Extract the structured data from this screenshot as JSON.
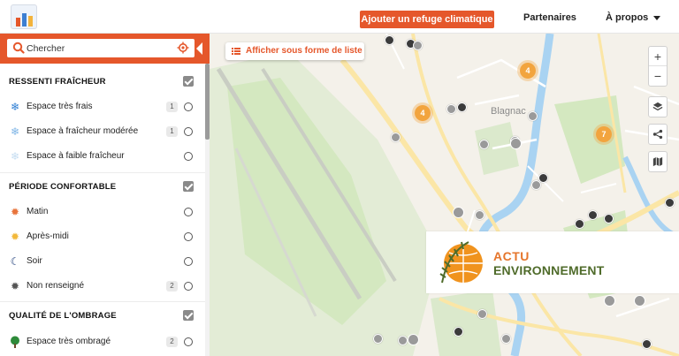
{
  "header": {
    "logo": "refuge-logo",
    "add_refuge_button": "Ajouter un refuge climatique",
    "partners_link": "Partenaires",
    "about_link": "À propos"
  },
  "search": {
    "placeholder": "Chercher",
    "icon": "magnifier-icon",
    "locate_icon": "crosshair-icon"
  },
  "sections": [
    {
      "title": "RESSENTI FRAÎCHEUR",
      "checked": true,
      "options": [
        {
          "label": "Espace très frais",
          "icon": "snowflake-icon",
          "icon_color": "#2f7fd4",
          "count": "1"
        },
        {
          "label": "Espace à fraîcheur modérée",
          "icon": "snowflake-icon",
          "icon_color": "#7fb5e6",
          "count": "1"
        },
        {
          "label": "Espace à faible fraîcheur",
          "icon": "snowflake-icon",
          "icon_color": "#c5ddf2",
          "count": ""
        }
      ]
    },
    {
      "title": "PÉRIODE CONFORTABLE",
      "checked": true,
      "options": [
        {
          "label": "Matin",
          "icon": "sun-icon",
          "icon_color": "#e8743b",
          "count": ""
        },
        {
          "label": "Après-midi",
          "icon": "sun-icon",
          "icon_color": "#f2b83a",
          "count": ""
        },
        {
          "label": "Soir",
          "icon": "moon-icon",
          "icon_color": "#1e3d7a",
          "count": ""
        },
        {
          "label": "Non renseigné",
          "icon": "sun-icon",
          "icon_color": "#555555",
          "count": "2"
        }
      ]
    },
    {
      "title": "QUALITÉ DE L'OMBRAGE",
      "checked": true,
      "options": [
        {
          "label": "Espace très ombragé",
          "icon": "tree-icon",
          "icon_color": "#2e8b3a",
          "count": "2"
        }
      ]
    }
  ],
  "map": {
    "list_view_button": "Afficher sous forme de liste",
    "zoom_in": "+",
    "zoom_out": "−",
    "place_label": "Blagnac",
    "clusters": [
      "4",
      "4",
      "7"
    ]
  },
  "watermark": {
    "line1": "ACTU",
    "line2": "ENVIRONNEMENT"
  },
  "colors": {
    "accent": "#e5572b",
    "cluster": "#f2a43e",
    "river": "#a9d3f2",
    "park": "#d4e8c0",
    "road": "#fbe6a6"
  }
}
